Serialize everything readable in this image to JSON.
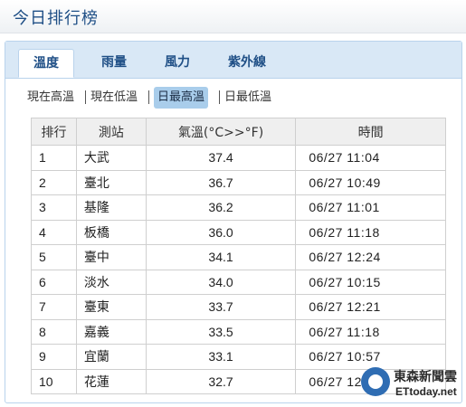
{
  "header": {
    "title": "今日排行榜"
  },
  "tabs": [
    {
      "label": "溫度",
      "active": true
    },
    {
      "label": "雨量",
      "active": false
    },
    {
      "label": "風力",
      "active": false
    },
    {
      "label": "紫外線",
      "active": false
    }
  ],
  "subtabs": [
    {
      "label": "現在高溫",
      "active": false
    },
    {
      "label": "現在低溫",
      "active": false
    },
    {
      "label": "日最高溫",
      "active": true
    },
    {
      "label": "日最低溫",
      "active": false
    }
  ],
  "table": {
    "columns": [
      "排行",
      "測站",
      "氣溫(°C>>°F)",
      "時間"
    ],
    "rows": [
      {
        "rank": "1",
        "station": "大武",
        "temp": "37.4",
        "time": "06/27 11:04"
      },
      {
        "rank": "2",
        "station": "臺北",
        "temp": "36.7",
        "time": "06/27 10:49"
      },
      {
        "rank": "3",
        "station": "基隆",
        "temp": "36.2",
        "time": "06/27 11:01"
      },
      {
        "rank": "4",
        "station": "板橋",
        "temp": "36.0",
        "time": "06/27 11:18"
      },
      {
        "rank": "5",
        "station": "臺中",
        "temp": "34.1",
        "time": "06/27 12:24"
      },
      {
        "rank": "6",
        "station": "淡水",
        "temp": "34.0",
        "time": "06/27 10:15"
      },
      {
        "rank": "7",
        "station": "臺東",
        "temp": "33.7",
        "time": "06/27 12:21"
      },
      {
        "rank": "8",
        "station": "嘉義",
        "temp": "33.5",
        "time": "06/27 11:18"
      },
      {
        "rank": "9",
        "station": "宜蘭",
        "temp": "33.1",
        "time": "06/27 10:57"
      },
      {
        "rank": "10",
        "station": "花蓮",
        "temp": "32.7",
        "time": "06/27 12:30"
      }
    ]
  },
  "watermark": {
    "name": "東森新聞雲",
    "site": "ETtoday.net"
  },
  "colors": {
    "accent": "#1f4f86",
    "tab_bar": "#d9e8f6",
    "active_subtab": "#a9cdeb",
    "border": "#b9d3ec"
  }
}
